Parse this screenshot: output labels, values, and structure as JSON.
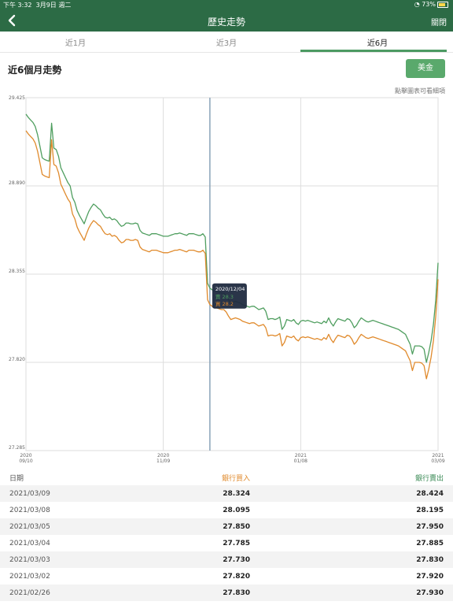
{
  "status": {
    "time": "下午 3:32",
    "date": "3月9日 週二",
    "battery": "73%"
  },
  "nav": {
    "title": "歷史走勢",
    "close": "關閉"
  },
  "tabs": [
    {
      "label": "近1月"
    },
    {
      "label": "近3月"
    },
    {
      "label": "近6月"
    }
  ],
  "active_tab": 2,
  "heading": "近6個月走勢",
  "currency_button": "美金",
  "hint": "點擊圖表可看細項",
  "chart_data": {
    "type": "line",
    "ylim": [
      27.285,
      29.425
    ],
    "yticks": [
      "29.425",
      "28.890",
      "28.355",
      "27.820",
      "27.285"
    ],
    "xticks": [
      {
        "top": "2020",
        "bottom": "09/10"
      },
      {
        "top": "2020",
        "bottom": "11/09"
      },
      {
        "top": "2021",
        "bottom": "01/08"
      },
      {
        "top": "2021",
        "bottom": "03/09"
      }
    ],
    "series": [
      {
        "name": "賣",
        "color": "#4f9e5f",
        "values": [
          29.325,
          29.305,
          29.29,
          29.275,
          29.25,
          29.2,
          29.13,
          29.06,
          29.05,
          29.045,
          29.04,
          29.27,
          29.12,
          29.11,
          29.07,
          29.0,
          28.97,
          28.94,
          28.91,
          28.89,
          28.82,
          28.79,
          28.74,
          28.71,
          28.685,
          28.66,
          28.7,
          28.735,
          28.76,
          28.78,
          28.77,
          28.755,
          28.745,
          28.72,
          28.7,
          28.695,
          28.7,
          28.685,
          28.69,
          28.68,
          28.66,
          28.645,
          28.65,
          28.665,
          28.665,
          28.66,
          28.66,
          28.665,
          28.66,
          28.62,
          28.605,
          28.6,
          28.595,
          28.59,
          28.6,
          28.6,
          28.6,
          28.595,
          28.59,
          28.585,
          28.585,
          28.585,
          28.59,
          28.595,
          28.6,
          28.6,
          28.605,
          28.6,
          28.595,
          28.59,
          28.6,
          28.6,
          28.6,
          28.595,
          28.59,
          28.59,
          28.6,
          28.58,
          28.3,
          28.27,
          28.26,
          28.25,
          28.25,
          28.245,
          28.24,
          28.24,
          28.225,
          28.2,
          28.18,
          28.185,
          28.19,
          28.185,
          28.18,
          28.17,
          28.165,
          28.16,
          28.155,
          28.16,
          28.16,
          28.15,
          28.14,
          28.145,
          28.15,
          28.13,
          28.08,
          28.085,
          28.085,
          28.08,
          28.085,
          28.095,
          28.02,
          28.04,
          28.08,
          28.075,
          28.07,
          28.08,
          28.06,
          28.05,
          28.07,
          28.075,
          28.07,
          28.075,
          28.07,
          28.065,
          28.06,
          28.065,
          28.06,
          28.055,
          28.07,
          28.06,
          28.09,
          28.06,
          28.04,
          28.065,
          28.085,
          28.08,
          28.075,
          28.07,
          28.085,
          28.08,
          28.06,
          28.03,
          28.045,
          28.07,
          28.09,
          28.08,
          28.07,
          28.065,
          28.07,
          28.075,
          28.07,
          28.065,
          28.06,
          28.055,
          28.05,
          28.045,
          28.04,
          28.035,
          28.03,
          28.025,
          28.02,
          28.01,
          28.0,
          27.99,
          27.96,
          27.93,
          27.87,
          27.92,
          27.92,
          27.92,
          27.915,
          27.9,
          27.82,
          27.88,
          27.95,
          28.05,
          28.195,
          28.424
        ]
      },
      {
        "name": "買",
        "color": "#e08a2c",
        "values": [
          29.225,
          29.205,
          29.19,
          29.175,
          29.15,
          29.1,
          29.03,
          28.96,
          28.95,
          28.945,
          28.94,
          29.17,
          29.02,
          29.01,
          28.97,
          28.9,
          28.87,
          28.84,
          28.81,
          28.79,
          28.72,
          28.69,
          28.64,
          28.61,
          28.585,
          28.56,
          28.6,
          28.635,
          28.66,
          28.68,
          28.67,
          28.655,
          28.645,
          28.62,
          28.6,
          28.595,
          28.6,
          28.585,
          28.59,
          28.58,
          28.56,
          28.545,
          28.55,
          28.565,
          28.565,
          28.56,
          28.56,
          28.565,
          28.56,
          28.52,
          28.505,
          28.5,
          28.495,
          28.49,
          28.5,
          28.5,
          28.5,
          28.495,
          28.49,
          28.485,
          28.485,
          28.485,
          28.49,
          28.495,
          28.5,
          28.5,
          28.505,
          28.5,
          28.495,
          28.49,
          28.5,
          28.5,
          28.5,
          28.495,
          28.49,
          28.49,
          28.5,
          28.48,
          28.2,
          28.17,
          28.16,
          28.15,
          28.15,
          28.145,
          28.14,
          28.14,
          28.125,
          28.1,
          28.08,
          28.085,
          28.09,
          28.085,
          28.08,
          28.07,
          28.065,
          28.06,
          28.055,
          28.06,
          28.06,
          28.05,
          28.04,
          28.045,
          28.05,
          28.03,
          27.98,
          27.985,
          27.985,
          27.98,
          27.985,
          27.995,
          27.92,
          27.94,
          27.98,
          27.975,
          27.97,
          27.98,
          27.96,
          27.95,
          27.97,
          27.975,
          27.97,
          27.975,
          27.97,
          27.965,
          27.96,
          27.965,
          27.96,
          27.955,
          27.97,
          27.96,
          27.99,
          27.96,
          27.94,
          27.965,
          27.985,
          27.98,
          27.975,
          27.97,
          27.985,
          27.98,
          27.96,
          27.93,
          27.945,
          27.97,
          27.99,
          27.98,
          27.97,
          27.965,
          27.97,
          27.975,
          27.97,
          27.965,
          27.96,
          27.955,
          27.95,
          27.945,
          27.94,
          27.935,
          27.93,
          27.925,
          27.92,
          27.91,
          27.9,
          27.89,
          27.86,
          27.83,
          27.77,
          27.82,
          27.82,
          27.82,
          27.815,
          27.8,
          27.72,
          27.78,
          27.85,
          27.95,
          28.095,
          28.324
        ]
      }
    ],
    "selected": {
      "index": 79,
      "date": "2020/12/04",
      "sell_label": "賣 28.3",
      "buy_label": "買 28.2"
    }
  },
  "table": {
    "headers": {
      "date": "日期",
      "buy": "銀行買入",
      "sell": "銀行賣出"
    },
    "rows": [
      {
        "date": "2021/03/09",
        "buy": "28.324",
        "sell": "28.424"
      },
      {
        "date": "2021/03/08",
        "buy": "28.095",
        "sell": "28.195"
      },
      {
        "date": "2021/03/05",
        "buy": "27.850",
        "sell": "27.950"
      },
      {
        "date": "2021/03/04",
        "buy": "27.785",
        "sell": "27.885"
      },
      {
        "date": "2021/03/03",
        "buy": "27.730",
        "sell": "27.830"
      },
      {
        "date": "2021/03/02",
        "buy": "27.820",
        "sell": "27.920"
      },
      {
        "date": "2021/02/26",
        "buy": "27.830",
        "sell": "27.930"
      }
    ]
  }
}
